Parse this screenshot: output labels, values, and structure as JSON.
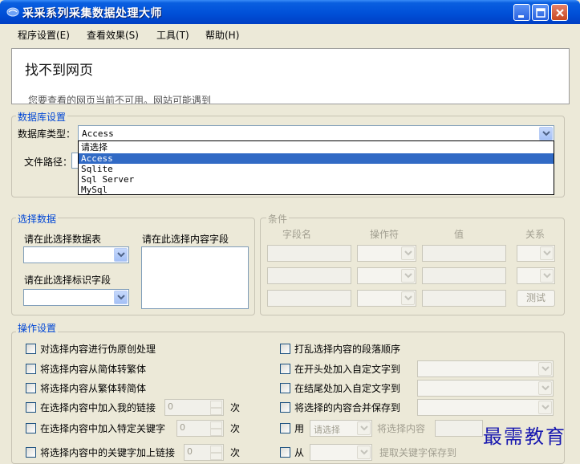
{
  "window": {
    "title": "采采系列采集数据处理大师",
    "controls": [
      "minimize",
      "maximize",
      "close"
    ]
  },
  "menu": [
    {
      "label": "程序设置(E)"
    },
    {
      "label": "查看效果(S)"
    },
    {
      "label": "工具(T)"
    },
    {
      "label": "帮助(H)"
    }
  ],
  "browser": {
    "heading": "找不到网页",
    "subtext": "您要查看的网页当前不可用。网站可能遇到"
  },
  "database": {
    "group_title": "数据库设置",
    "type_label": "数据库类型：",
    "type_value": "Access",
    "path_label": "文件路径：",
    "options": [
      {
        "label": "请选择",
        "selected": false
      },
      {
        "label": "Access",
        "selected": true
      },
      {
        "label": "Sqlite",
        "selected": false
      },
      {
        "label": "Sql Server",
        "selected": false
      },
      {
        "label": "MySql",
        "selected": false
      }
    ]
  },
  "select_data": {
    "group_title": "选择数据",
    "table_label": "请在此选择数据表",
    "content_field_label": "请在此选择内容字段",
    "id_field_label": "请在此选择标识字段"
  },
  "conditions": {
    "group_title": "条件",
    "headers": [
      "字段名",
      "操作符",
      "值",
      "关系"
    ],
    "rows": 3,
    "test_button": "测试"
  },
  "operations": {
    "group_title": "操作设置",
    "left": [
      {
        "label": "对选择内容进行伪原创处理"
      },
      {
        "label": "将选择内容从简体转繁体"
      },
      {
        "label": "将选择内容从繁体转简体"
      },
      {
        "label": "在选择内容中加入我的链接",
        "value": "0",
        "suffix": "次"
      },
      {
        "label": "在选择内容中加入特定关键字",
        "value": "0",
        "suffix": "次"
      },
      {
        "label": "将选择内容中的关键字加上链接",
        "value": "0",
        "suffix": "次"
      }
    ],
    "right": [
      {
        "label": "打乱选择内容的段落顺序"
      },
      {
        "label": "在开头处加入自定文字到"
      },
      {
        "label": "在结尾处加入自定文字到"
      },
      {
        "label": "将选择的内容合并保存到"
      },
      {
        "label": "用",
        "combo_value": "请选择",
        "tail": "将选择内容"
      },
      {
        "label": "从",
        "tail": "提取关键字保存到"
      }
    ]
  },
  "watermark": "最需教育",
  "colors": {
    "titlebar": "#0050d8",
    "window_bg": "#ece9d8",
    "group_title": "#0046d5",
    "selection": "#316ac5",
    "watermark": "#1a1ab0"
  }
}
